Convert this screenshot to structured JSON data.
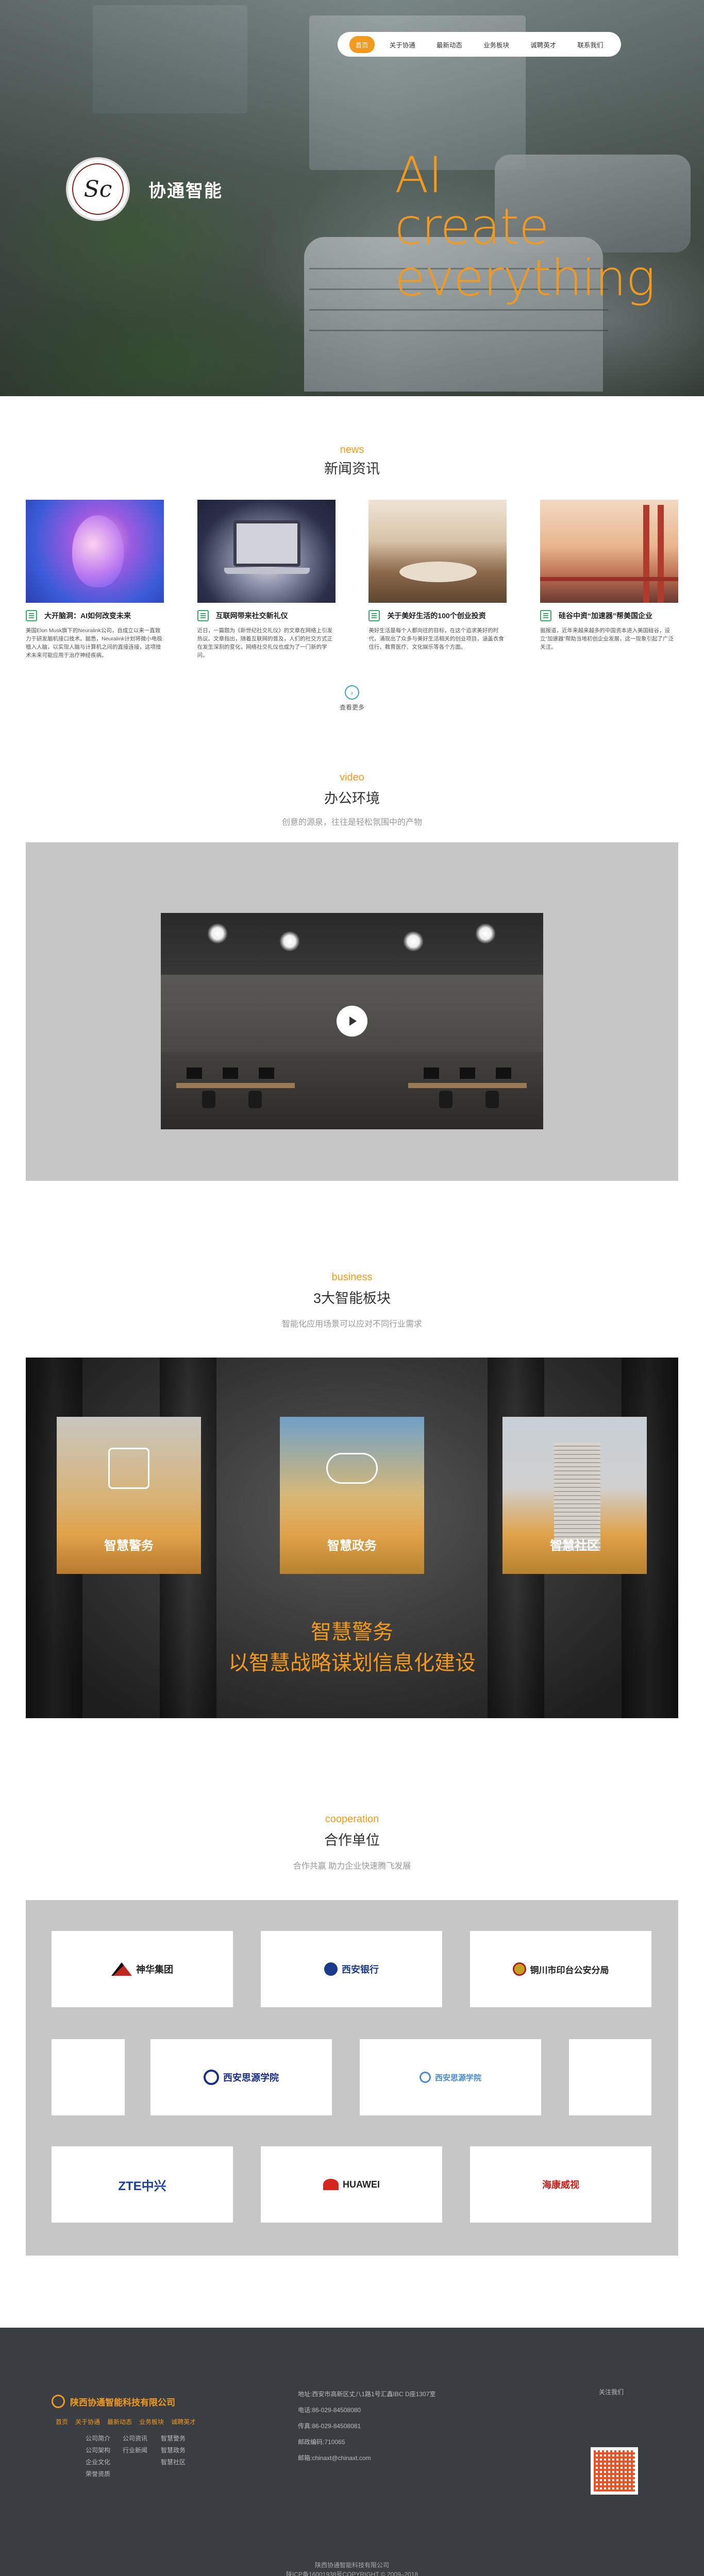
{
  "nav": {
    "items": [
      "首页",
      "关于协通",
      "最新动态",
      "业务板块",
      "诚聘英才",
      "联系我们"
    ],
    "active_index": 0
  },
  "hero": {
    "brand_name": "协通智能",
    "logo_text": "Sc",
    "slogan_lines": [
      "AI",
      "create",
      "everything"
    ]
  },
  "news": {
    "title_en": "news",
    "title_cn": "新闻资讯",
    "items": [
      {
        "title": "大开脑洞：AI如何改变未来",
        "text": "美国Elon Musk旗下的Neuralink公司，自成立以来一直致力于研发脑机接口技术。据悉，Neuralink计划将微小电极植入人脑，以实现人脑与计算机之间的直接连接，这项技术未来可能应用于治疗神经疾病。"
      },
      {
        "title": "互联网带来社交新礼仪",
        "text": "近日，一篇题为《新世纪社交礼仪》的文章在网络上引发热议。文章指出，随着互联网的普及，人们的社交方式正在发生深刻的变化，网络社交礼仪也成为了一门新的学问。"
      },
      {
        "title": "关于美好生活的100个创业投资",
        "text": "美好生活是每个人都向往的目标，在这个追求美好的时代，涌现出了众多与美好生活相关的创业项目，涵盖衣食住行、教育医疗、文化娱乐等各个方面。"
      },
      {
        "title": "硅谷中资“加速器”帮美国企业",
        "text": "据报道，近年来越来越多的中国资本进入美国硅谷，设立“加速器”帮助当地初创企业发展，这一现象引起了广泛关注。"
      }
    ],
    "more_label": "查看更多"
  },
  "video": {
    "title_en": "video",
    "title_cn": "办公环境",
    "subtitle": "创意的源泉，往往是轻松氛围中的产物"
  },
  "business": {
    "title_en": "business",
    "title_cn": "3大智能板块",
    "subtitle": "智能化应用场景可以应对不同行业需求",
    "cards": [
      "智慧警务",
      "智慧政务",
      "智慧社区"
    ],
    "feature_title": "智慧警务",
    "feature_sub": "以智慧战略谋划信息化建设"
  },
  "cooperation": {
    "title_en": "cooperation",
    "title_cn": "合作单位",
    "subtitle": "合作共赢 助力企业快速腾飞发展",
    "partners": [
      "神华集团",
      "西安银行",
      "铜川市印台公安分局",
      "",
      "西安思源学院",
      "西安思源学院",
      "",
      "ZTE中兴",
      "HUAWEI",
      "海康威视"
    ]
  },
  "footer": {
    "company": "陕西协通智能科技有限公司",
    "nav": [
      "首页",
      "关于协通",
      "最新动态",
      "业务板块",
      "诚聘英才"
    ],
    "col1": [
      "公司简介",
      "公司架构",
      "企业文化",
      "荣誉资质"
    ],
    "col2": [
      "公司资讯",
      "行业新闻"
    ],
    "col3": [
      "智慧警务",
      "智慧政务",
      "智慧社区"
    ],
    "contact": [
      "地址:西安市高新区丈八1路1号汇鑫IBC D座1307室",
      "电话:86-029-84508080",
      "传真:86-029-84508081",
      "邮政编码:710065",
      "邮箱:chinaxt@chinaxt.com"
    ],
    "qr_label": "关注我们",
    "copyright_lines": [
      "陕西协通智能科技有限公司",
      "陕ICP备16001938号COPYRIGHT © 2009–2018"
    ]
  },
  "colors": {
    "accent": "#f39a1e",
    "panel_gray": "#c6c6c6",
    "footer_bg": "#3a3d42"
  }
}
